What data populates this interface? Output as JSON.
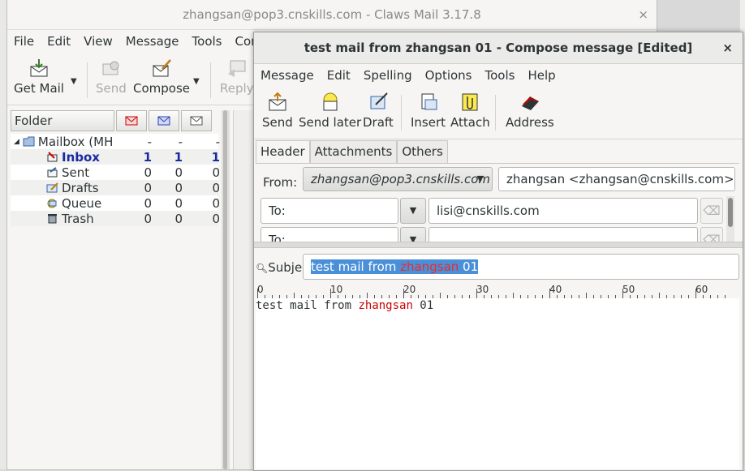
{
  "main_window": {
    "title": "zhangsan@pop3.cnskills.com - Claws Mail 3.17.8",
    "close": "×",
    "menu": [
      "File",
      "Edit",
      "View",
      "Message",
      "Tools",
      "Confi"
    ],
    "toolbar": {
      "get_mail": "Get Mail",
      "send": "Send",
      "compose": "Compose",
      "reply": "Reply"
    },
    "folder_header": "Folder",
    "folders": [
      {
        "name": "Mailbox (MH",
        "new": "-",
        "unread": "-",
        "total": "-"
      },
      {
        "name": "Inbox",
        "new": "1",
        "unread": "1",
        "total": "1"
      },
      {
        "name": "Sent",
        "new": "0",
        "unread": "0",
        "total": "0"
      },
      {
        "name": "Drafts",
        "new": "0",
        "unread": "0",
        "total": "0"
      },
      {
        "name": "Queue",
        "new": "0",
        "unread": "0",
        "total": "0"
      },
      {
        "name": "Trash",
        "new": "0",
        "unread": "0",
        "total": "0"
      }
    ]
  },
  "compose_window": {
    "title": "test mail from zhangsan 01 - Compose message [Edited]",
    "close": "×",
    "menu": [
      "Message",
      "Edit",
      "Spelling",
      "Options",
      "Tools",
      "Help"
    ],
    "toolbar": {
      "send": "Send",
      "send_later": "Send later",
      "draft": "Draft",
      "insert": "Insert",
      "attach": "Attach",
      "address": "Address"
    },
    "tabs": [
      "Header",
      "Attachments",
      "Others"
    ],
    "from_label": "From:",
    "from_account": "zhangsan@pop3.cnskills.com",
    "from_address": "zhangsan <zhangsan@cnskills.com>",
    "recipients": [
      {
        "type": "To:",
        "value": "lisi@cnskills.com"
      },
      {
        "type": "To:",
        "value": ""
      }
    ],
    "subject_label": "Subject:",
    "subject_parts": [
      "test mail from ",
      "zhangsan",
      " 01"
    ],
    "ruler": [
      "0",
      "10",
      "20",
      "30",
      "40",
      "50",
      "60"
    ],
    "body_parts": [
      "test mail from ",
      "zhangsan",
      " 01"
    ]
  },
  "colors": {
    "selection": "#4a90d9",
    "misspelled": "#cc0000",
    "unread_folder": "#1a2ba0"
  }
}
